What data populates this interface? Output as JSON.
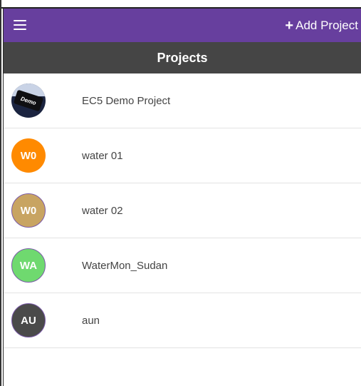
{
  "appbar": {
    "add_label": "Add Project",
    "add_icon": "plus-icon",
    "menu_icon": "hamburger-menu-icon",
    "background": "#673f9e"
  },
  "title": {
    "text": "Projects",
    "background": "#454545"
  },
  "projects": [
    {
      "name": "EC5 Demo Project",
      "avatar_text": "Demo",
      "avatar_type": "logo"
    },
    {
      "name": "water 01",
      "avatar_text": "W0",
      "avatar_color": "#ff8a00"
    },
    {
      "name": "water 02",
      "avatar_text": "W0",
      "avatar_color": "#c8a462"
    },
    {
      "name": "WaterMon_Sudan",
      "avatar_text": "WA",
      "avatar_color": "#6fd96f"
    },
    {
      "name": "aun",
      "avatar_text": "AU",
      "avatar_color": "#4a4a4a"
    }
  ]
}
